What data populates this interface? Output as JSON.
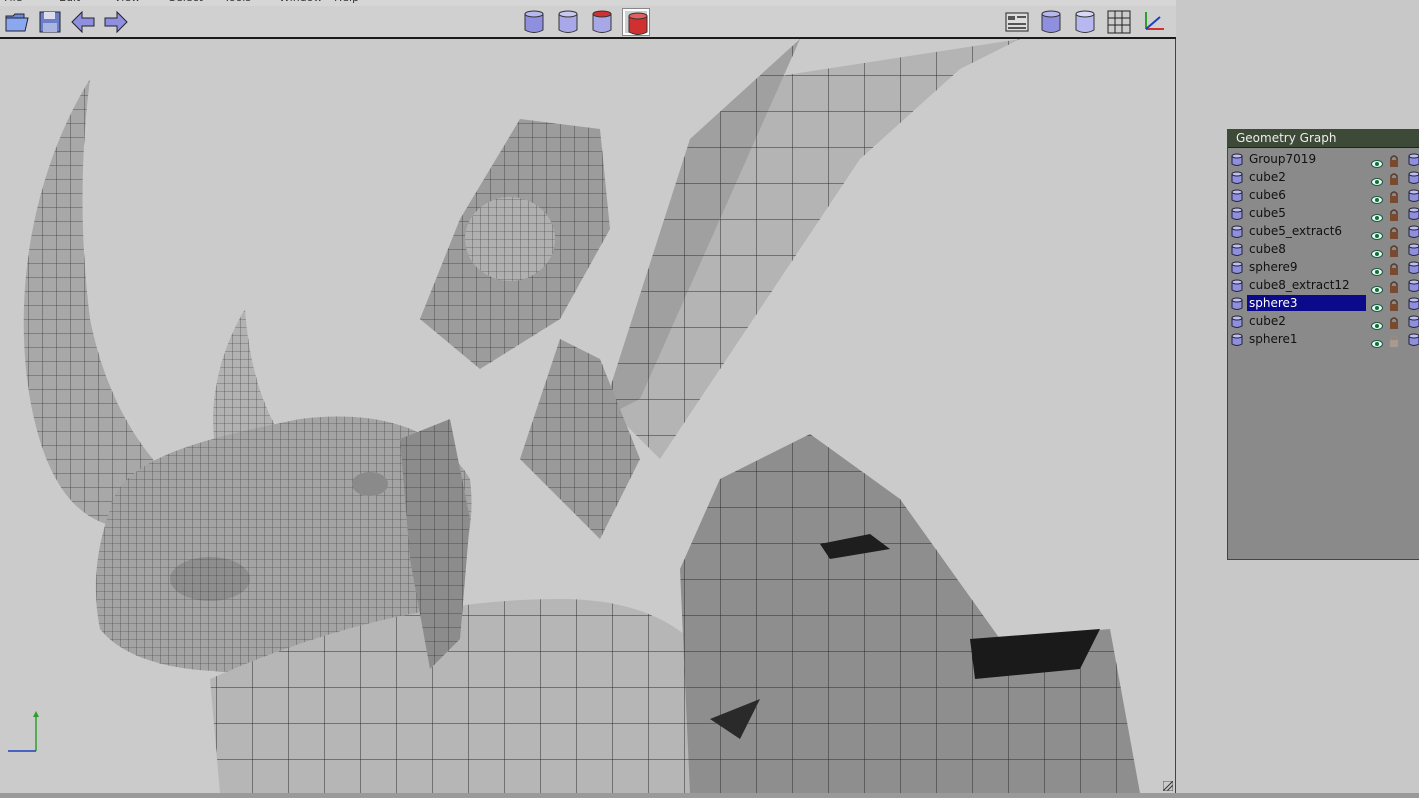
{
  "menu": [
    "File",
    "Edit",
    "View",
    "Select",
    "Tools",
    "Window",
    "Help"
  ],
  "toolbar": {
    "left_icons": [
      "open-folder-icon",
      "save-disk-icon",
      "undo-arrow-icon",
      "redo-arrow-icon"
    ],
    "center_icons": [
      "cylinder-object-mode-icon",
      "cylinder-face-mode-icon",
      "cylinder-edge-mode-icon",
      "cylinder-vertex-mode-icon"
    ],
    "selected_center_index": 3,
    "right_icons": [
      "panel-layout-icon",
      "cylinder-shaded-icon",
      "cylinder-flat-icon",
      "grid-icon",
      "axes-icon"
    ]
  },
  "geometry_graph": {
    "title": "Geometry Graph",
    "items": [
      {
        "label": "Group7019",
        "visible": true,
        "locked": true
      },
      {
        "label": "cube2",
        "visible": true,
        "locked": true
      },
      {
        "label": "cube6",
        "visible": true,
        "locked": true
      },
      {
        "label": "cube5",
        "visible": true,
        "locked": true
      },
      {
        "label": "cube5_extract6",
        "visible": true,
        "locked": true
      },
      {
        "label": "cube8",
        "visible": true,
        "locked": true
      },
      {
        "label": "sphere9",
        "visible": true,
        "locked": true
      },
      {
        "label": "cube8_extract12",
        "visible": true,
        "locked": true
      },
      {
        "label": "sphere3",
        "visible": true,
        "locked": true,
        "selected": true
      },
      {
        "label": "cube2",
        "visible": true,
        "locked": true
      },
      {
        "label": "sphere1",
        "visible": true,
        "locked": false
      }
    ]
  },
  "colors": {
    "selection": "#0a0a8a",
    "panel_header": "#3d4a38",
    "icon_purple": "#8f8fe0",
    "icon_red": "#d03030",
    "axis_green": "#2ca02c",
    "axis_blue": "#1f3fbf"
  }
}
